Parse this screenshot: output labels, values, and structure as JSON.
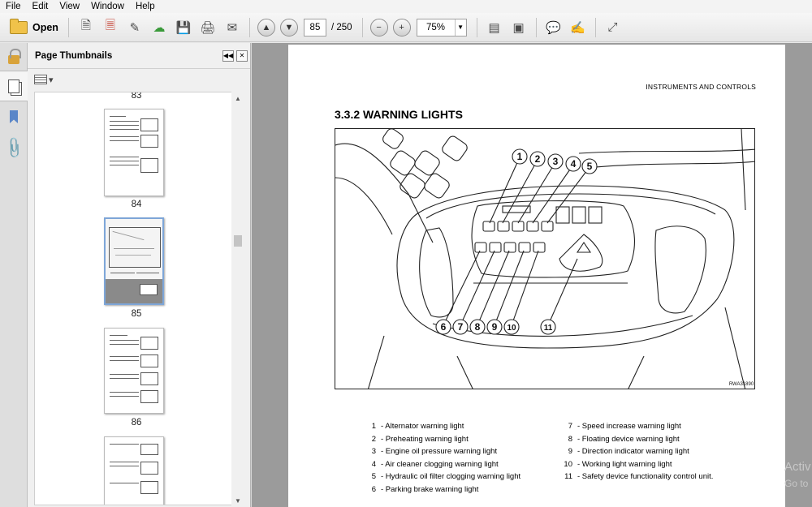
{
  "menu": [
    "File",
    "Edit",
    "View",
    "Window",
    "Help"
  ],
  "toolbar": {
    "open_label": "Open",
    "page_current": "85",
    "page_total": "/ 250",
    "zoom": "75%"
  },
  "panel": {
    "title": "Page Thumbnails"
  },
  "thumbnails": [
    "83",
    "84",
    "85",
    "86"
  ],
  "document": {
    "header": "INSTRUMENTS AND CONTROLS",
    "section": "3.3.2   WARNING LIGHTS",
    "figure_code": "RWA31890",
    "callouts": [
      "1",
      "2",
      "3",
      "4",
      "5",
      "6",
      "7",
      "8",
      "9",
      "10",
      "11"
    ],
    "legend_left": [
      {
        "num": "1",
        "text": "- Alternator warning light"
      },
      {
        "num": "2",
        "text": "- Preheating warning light"
      },
      {
        "num": "3",
        "text": "- Engine oil pressure warning light"
      },
      {
        "num": "4",
        "text": "- Air cleaner clogging warning light"
      },
      {
        "num": "5",
        "text": "- Hydraulic oil filter clogging warning light"
      },
      {
        "num": "6",
        "text": "- Parking brake warning light"
      }
    ],
    "legend_right": [
      {
        "num": "7",
        "text": "- Speed increase warning light"
      },
      {
        "num": "8",
        "text": "- Floating device warning light"
      },
      {
        "num": "9",
        "text": "- Direction indicator warning light"
      },
      {
        "num": "10",
        "text": "- Working light warning light"
      },
      {
        "num": "11",
        "text": "- Safety device functionality control unit."
      }
    ]
  },
  "watermark": {
    "line1": "Activ",
    "line2": "Go to"
  },
  "icons": [
    "open-folder-icon",
    "create-pdf-icon",
    "convert-icon",
    "edit-icon",
    "upload-icon",
    "save-icon",
    "print-icon",
    "email-icon",
    "prev-page-icon",
    "next-page-icon",
    "zoom-out-icon",
    "zoom-in-icon",
    "fit-page-icon",
    "fit-width-icon",
    "comment-icon",
    "sign-icon",
    "expand-icon",
    "lock-icon",
    "pages-icon",
    "bookmark-icon",
    "attachment-icon"
  ]
}
